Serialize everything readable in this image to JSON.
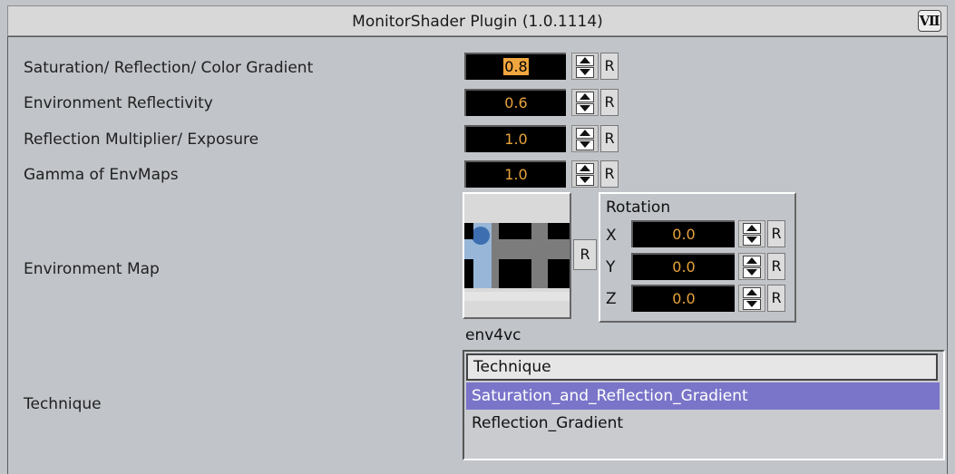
{
  "window": {
    "title": "MonitorShader Plugin (1.0.1114)",
    "logo_icon": "viz-logo-icon"
  },
  "rows": [
    {
      "label": "Saturation/ Reflection/ Color Gradient",
      "value": "0.8",
      "selected": true
    },
    {
      "label": "Environment Reflectivity",
      "value": "0.6"
    },
    {
      "label": "Reflection Multiplier/ Exposure",
      "value": "1.0"
    },
    {
      "label": "Gamma of EnvMaps",
      "value": "1.0"
    }
  ],
  "reset_label": "R",
  "environment": {
    "label": "Environment Map",
    "map_name": "env4vc"
  },
  "rotation": {
    "title": "Rotation",
    "axes": [
      {
        "axis": "X",
        "value": "0.0"
      },
      {
        "axis": "Y",
        "value": "0.0"
      },
      {
        "axis": "Z",
        "value": "0.0"
      }
    ]
  },
  "technique": {
    "label": "Technique",
    "header": "Technique",
    "options": [
      "Saturation_and_Reflection_Gradient",
      "Reflection_Gradient"
    ],
    "selected_index": 0
  },
  "colors": {
    "value_text": "#e8a33c",
    "selection": "#7a75c9",
    "background": "#c1c4c9"
  }
}
